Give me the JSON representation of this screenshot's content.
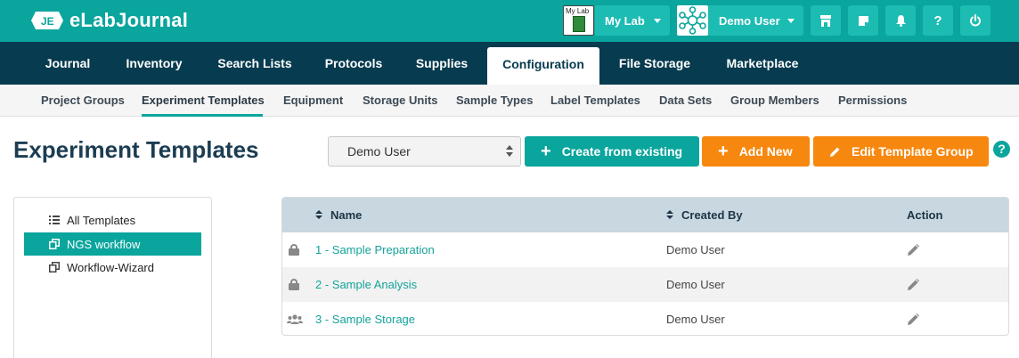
{
  "app": {
    "name": "eLabJournal",
    "logo_mark": "JE"
  },
  "topbar": {
    "lab_thumb_label": "My Lab",
    "lab_label": "My Lab",
    "user_label": "Demo User",
    "icons": [
      "store-icon",
      "notes-icon",
      "bell-icon",
      "help-icon",
      "power-icon"
    ],
    "help_glyph": "?"
  },
  "nav": {
    "items": [
      "Journal",
      "Inventory",
      "Search Lists",
      "Protocols",
      "Supplies",
      "Configuration",
      "File Storage",
      "Marketplace"
    ],
    "active": "Configuration"
  },
  "subnav": {
    "items": [
      "Project Groups",
      "Experiment Templates",
      "Equipment",
      "Storage Units",
      "Sample Types",
      "Label Templates",
      "Data Sets",
      "Group Members",
      "Permissions"
    ],
    "active": "Experiment Templates"
  },
  "page": {
    "title": "Experiment Templates",
    "group_select_value": "Demo User",
    "btn_create_from_existing": "Create from existing",
    "btn_add_new": "Add New",
    "btn_edit_template_group": "Edit Template Group",
    "help_glyph": "?"
  },
  "tree": {
    "items": [
      {
        "label": "All Templates",
        "icon": "list-icon",
        "active": false
      },
      {
        "label": "NGS workflow",
        "icon": "copy-icon",
        "active": true
      },
      {
        "label": "Workflow-Wizard",
        "icon": "copy-icon",
        "active": false
      }
    ]
  },
  "table": {
    "columns": {
      "name": "Name",
      "created_by": "Created By",
      "action": "Action"
    },
    "rows": [
      {
        "icon": "lock-icon",
        "name": "1 - Sample Preparation",
        "created_by": "Demo User"
      },
      {
        "icon": "lock-icon",
        "name": "2 - Sample Analysis",
        "created_by": "Demo User"
      },
      {
        "icon": "users-icon",
        "name": "3 - Sample Storage",
        "created_by": "Demo User"
      }
    ]
  },
  "colors": {
    "brand_teal": "#0aa59d",
    "nav_dark": "#073b4f",
    "accent_orange": "#f7880f",
    "table_header": "#c8d7e0"
  }
}
